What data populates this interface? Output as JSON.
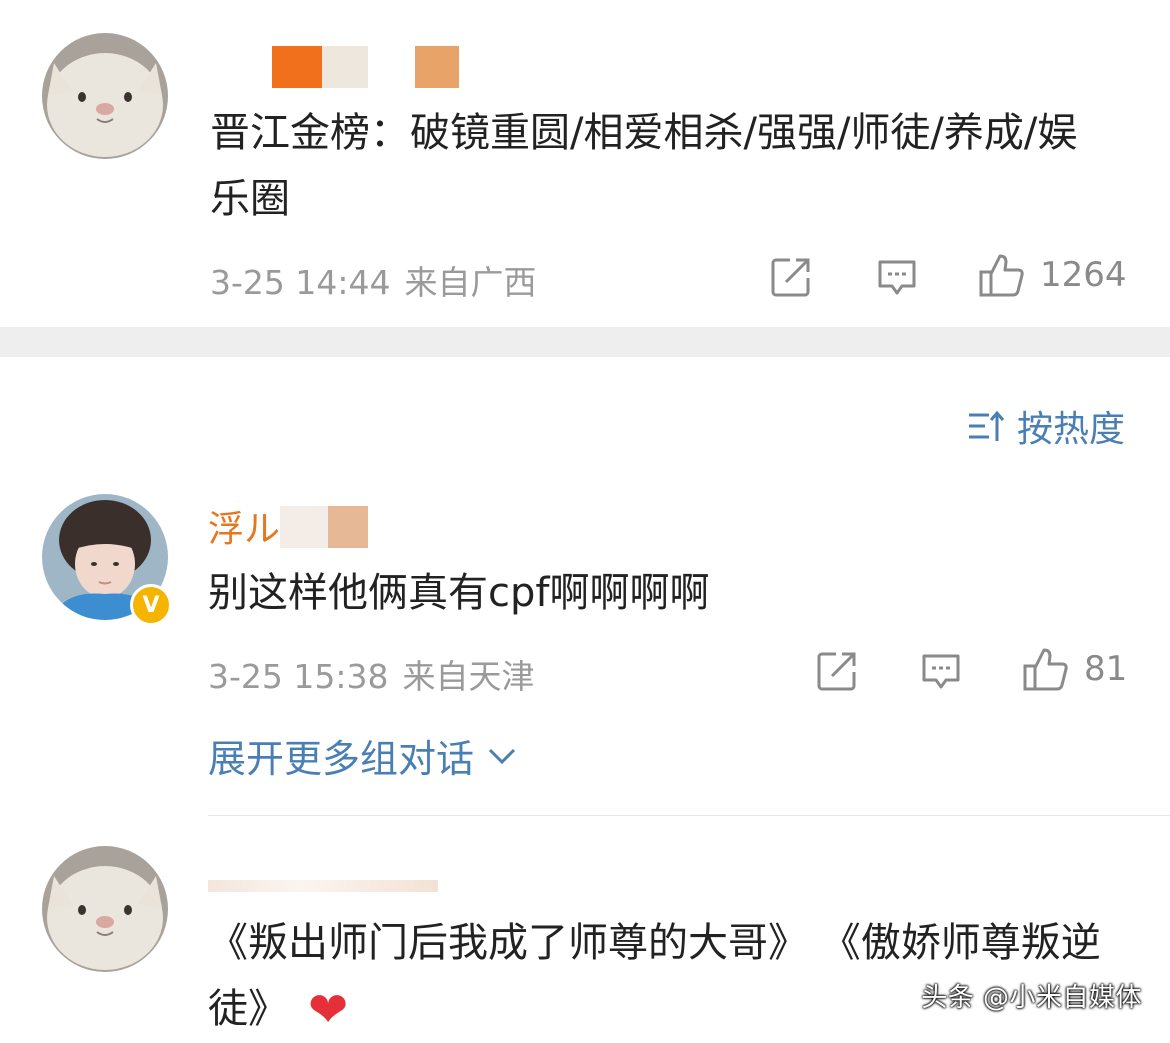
{
  "comments": [
    {
      "username_visible": "",
      "content": "晋江金榜：破镜重圆/相爱相杀/强强/师徒/养成/娱乐圈",
      "time": "3-25 14:44",
      "location": "来自广西",
      "likes": "1264"
    },
    {
      "username_visible": "浮ル",
      "content": "别这样他俩真有cpf啊啊啊啊",
      "time": "3-25 15:38",
      "location": "来自天津",
      "likes": "81",
      "expand_label": "展开更多组对话"
    },
    {
      "username_visible": "",
      "content": "《叛出师门后我成了师尊的大哥》 《傲娇师尊叛逆徒》",
      "heart": "❤"
    }
  ],
  "sort_label": "按热度",
  "watermark": "头条 @小米自媒体",
  "colors": {
    "username": "#e4771f",
    "link": "#4a7fb6",
    "meta": "#9a9a9a",
    "heart": "#e5303a",
    "badge": "#f5b400"
  },
  "icons": [
    "share-icon",
    "comment-icon",
    "like-icon",
    "sort-icon",
    "chevron-down-icon",
    "verified-badge-icon"
  ]
}
